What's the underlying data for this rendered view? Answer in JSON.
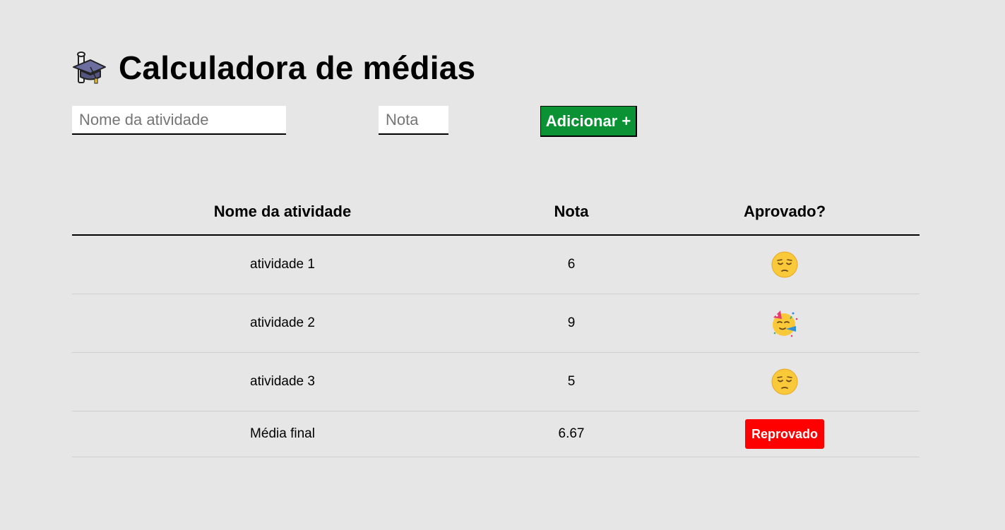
{
  "header": {
    "icon": "graduation-cap-icon",
    "title": "Calculadora de médias"
  },
  "form": {
    "name_placeholder": "Nome da atividade",
    "grade_placeholder": "Nota",
    "add_label": "Adicionar +",
    "add_color": "#0a9234"
  },
  "table": {
    "headers": [
      "Nome da atividade",
      "Nota",
      "Aprovado?"
    ],
    "rows": [
      {
        "name": "atividade 1",
        "grade": "6",
        "status_icon": "pensive-face-emoji"
      },
      {
        "name": "atividade 2",
        "grade": "9",
        "status_icon": "partying-face-emoji"
      },
      {
        "name": "atividade 3",
        "grade": "5",
        "status_icon": "pensive-face-emoji"
      }
    ],
    "final": {
      "label": "Média final",
      "value": "6.67",
      "result": "Reprovado",
      "result_color": "#ff0000"
    }
  }
}
